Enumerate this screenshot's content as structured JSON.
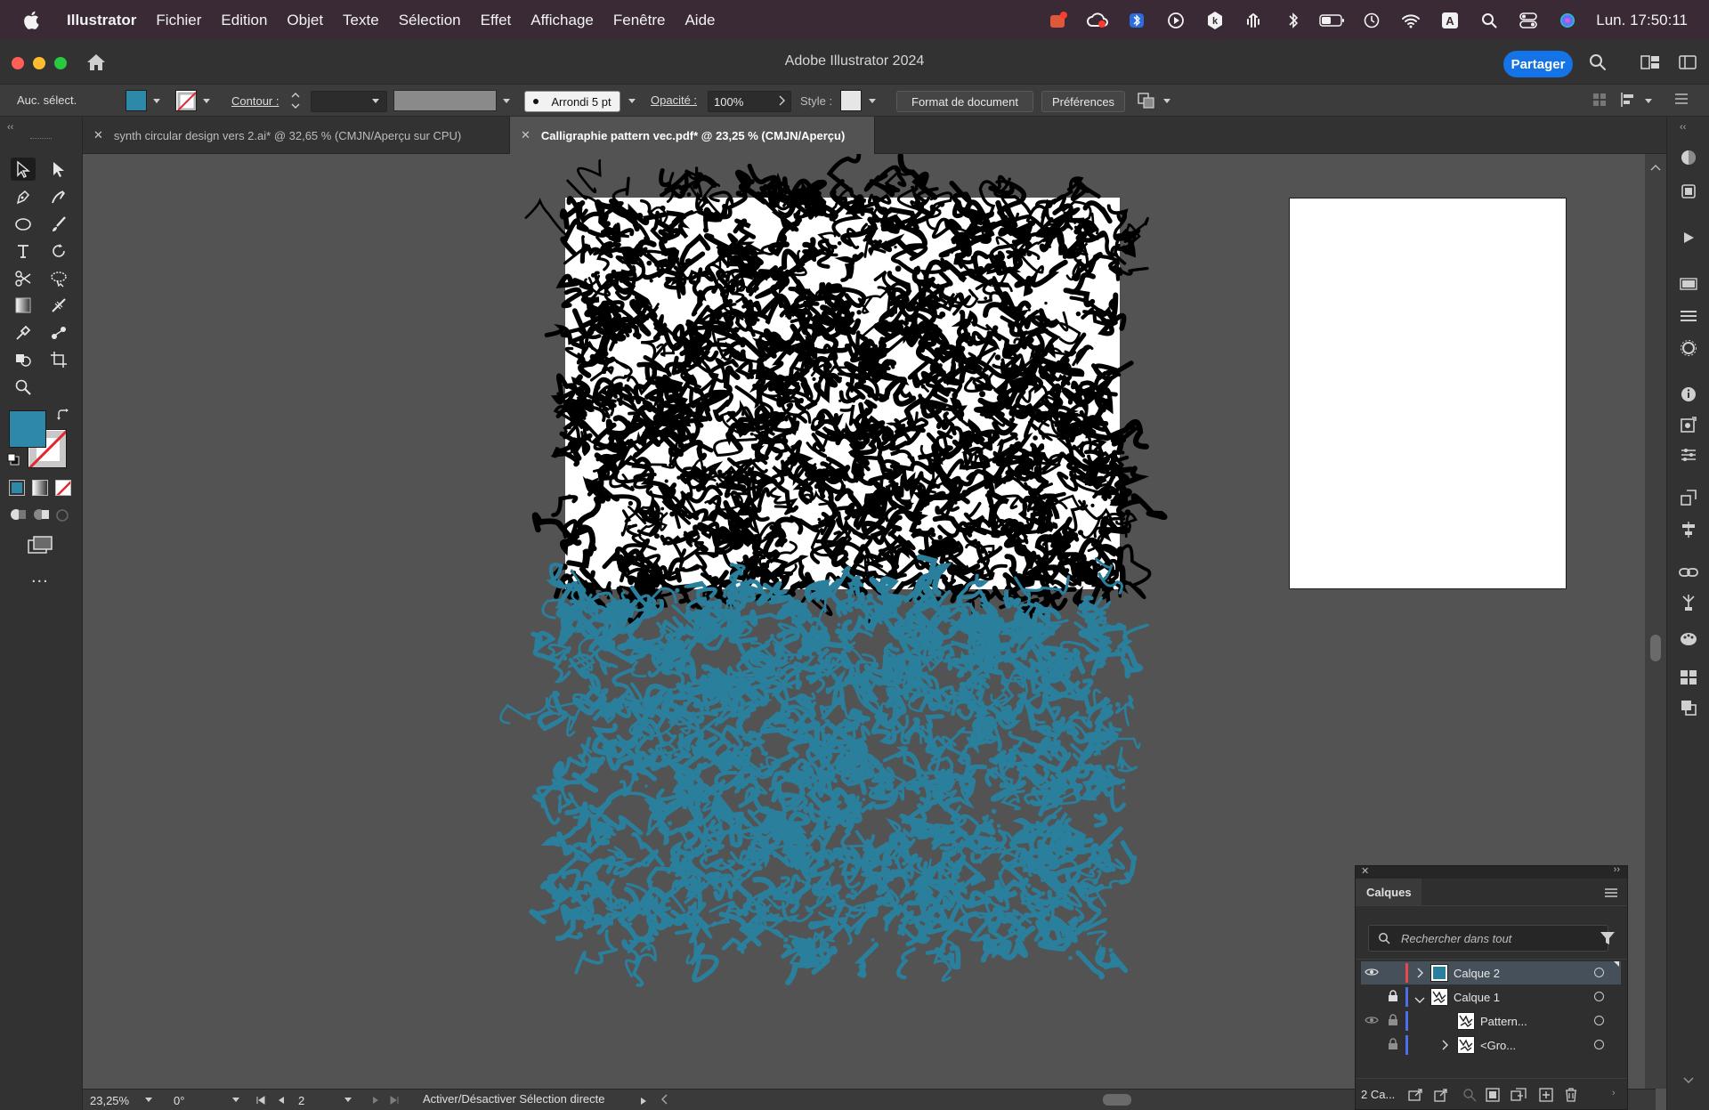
{
  "menubar": {
    "app_name": "Illustrator",
    "items": [
      "Fichier",
      "Edition",
      "Objet",
      "Texte",
      "Sélection",
      "Effet",
      "Affichage",
      "Fenêtre",
      "Aide"
    ],
    "clock": "Lun.  17:50:11",
    "status_icons": [
      "notification-badge-icon",
      "creative-cloud-icon",
      "bluetooth-app-icon",
      "play-icon",
      "k-app-icon",
      "audio-icon",
      "bluetooth-icon",
      "battery-icon",
      "time-machine-icon",
      "wifi-icon",
      "keyboard-input-icon",
      "spotlight-icon",
      "control-center-icon",
      "siri-icon"
    ]
  },
  "window": {
    "title": "Adobe Illustrator 2024",
    "share_label": "Partager"
  },
  "controlbar": {
    "selection_status": "Auc. sélect.",
    "fill_color": "#2e88a8",
    "stroke_label": "Contour :",
    "brush_label": "Arrondi 5 pt",
    "opacity_label": "Opacité :",
    "opacity_value": "100%",
    "style_label": "Style :",
    "document_setup_label": "Format de document",
    "preferences_label": "Préférences"
  },
  "tabs": [
    {
      "label": "synth circular design vers 2.ai* @ 32,65 % (CMJN/Aperçu sur CPU)",
      "active": false
    },
    {
      "label": "Calligraphie pattern vec.pdf* @ 23,25 % (CMJN/Aperçu)",
      "active": true
    }
  ],
  "toolbar": {
    "fill_color": "#2e88a8",
    "more_label": "..."
  },
  "statusbar": {
    "zoom": "23,25%",
    "rotation": "0°",
    "artboard_number": "2",
    "status_text": "Activer/Désactiver Sélection directe"
  },
  "layers_panel": {
    "title": "Calques",
    "search_placeholder": "Rechercher dans tout",
    "rows": [
      {
        "name": "Calque 2",
        "color": "#e8474c",
        "selected": true
      },
      {
        "name": "Calque 1",
        "color": "#4f6fe8",
        "selected": false
      },
      {
        "name": "Pattern...",
        "color": "#4f6fe8",
        "selected": false
      },
      {
        "name": "<Gro...",
        "color": "#4f6fe8",
        "selected": false
      }
    ],
    "layer_count": "2 Ca..."
  },
  "artwork": {
    "black_pattern_color": "#000000",
    "blue_pattern_color": "#2a7f9c"
  }
}
